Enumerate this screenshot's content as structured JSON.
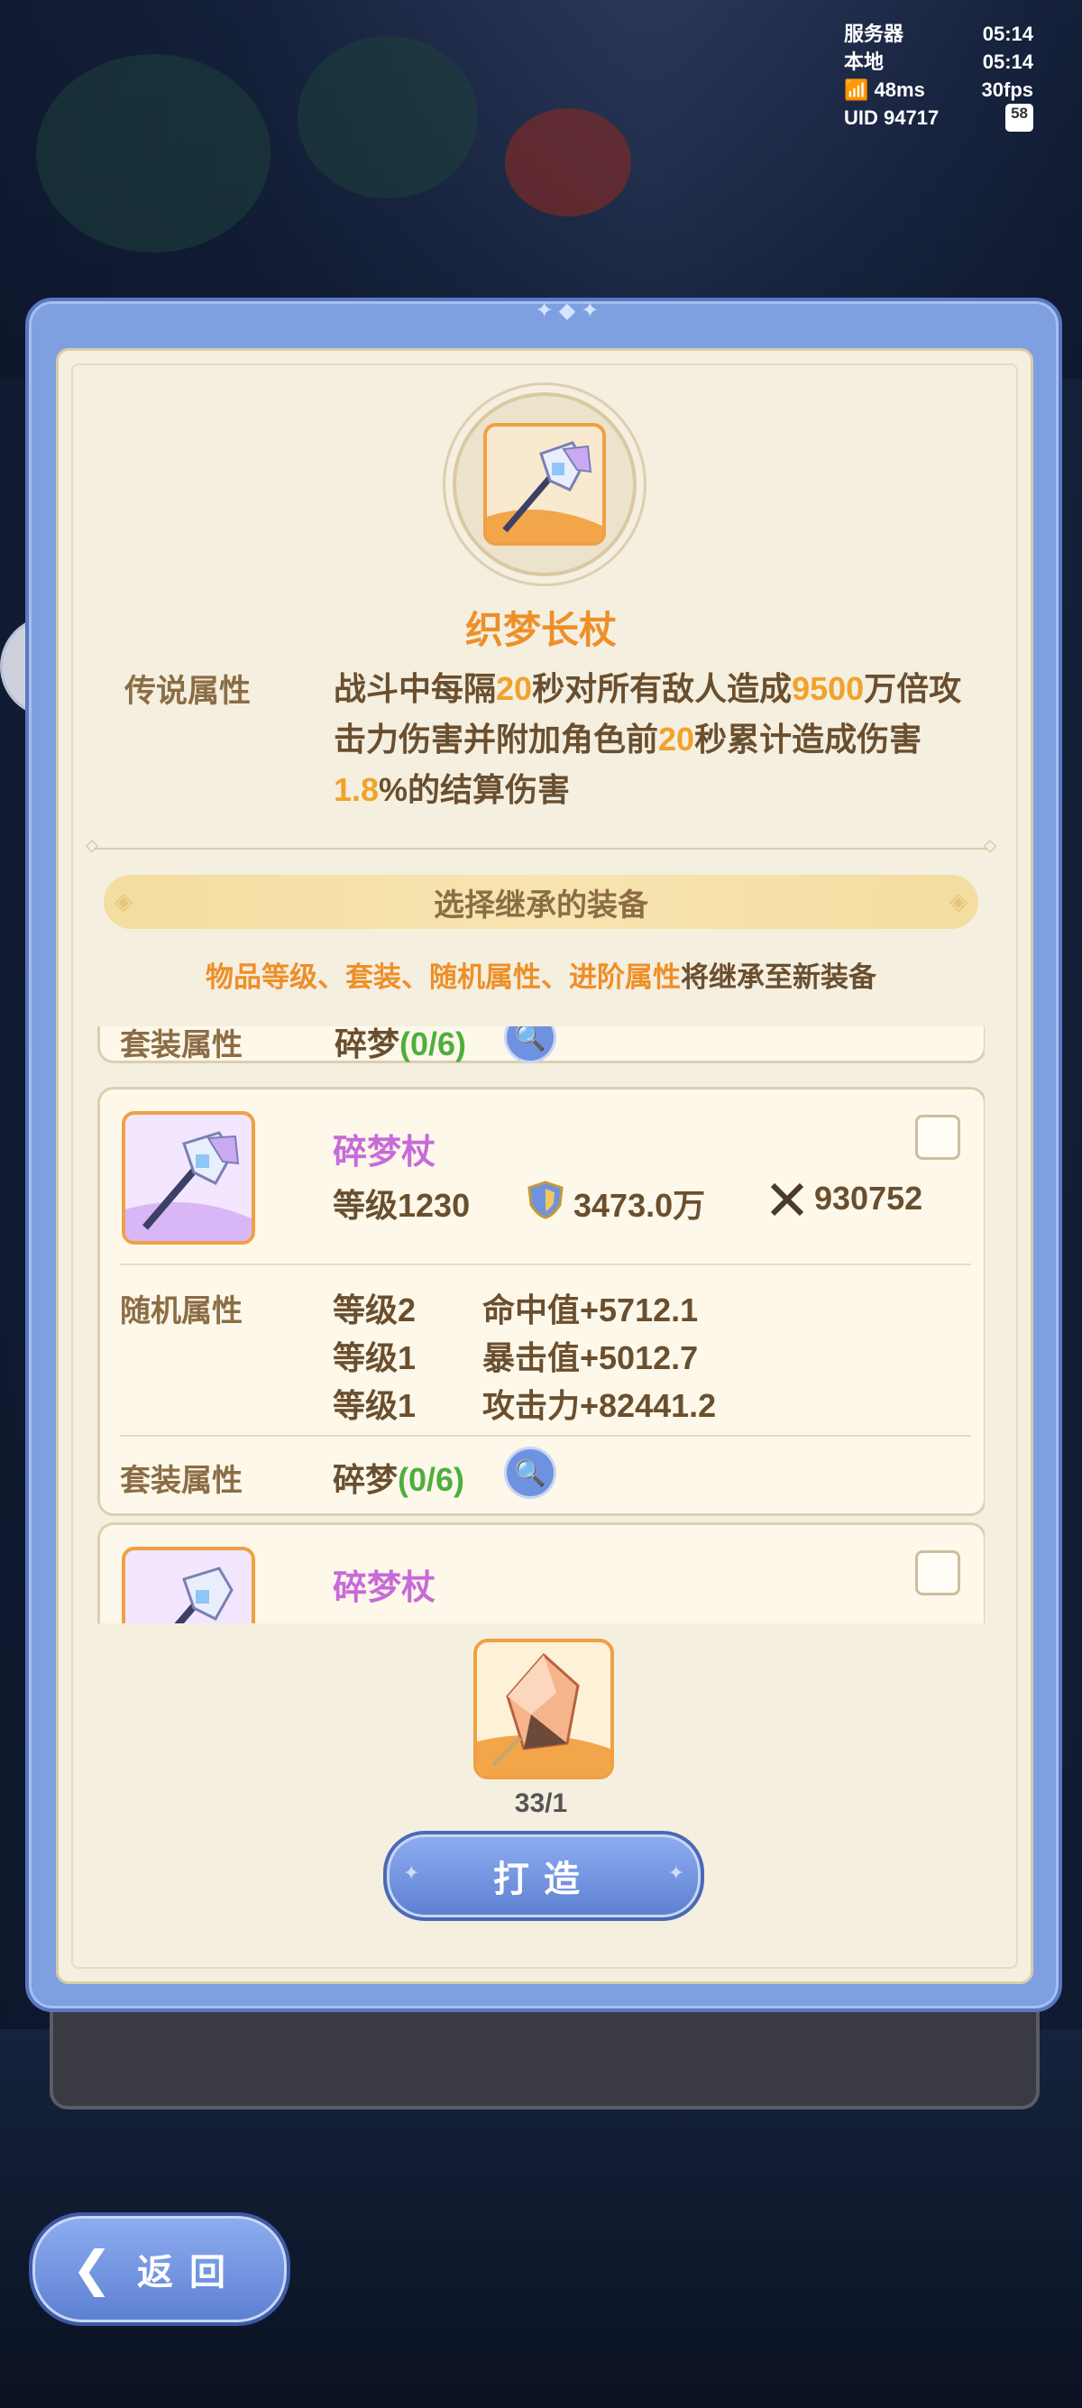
{
  "status": {
    "server_label": "服务器",
    "server_time": "05:14",
    "local_label": "本地",
    "local_time": "05:14",
    "ping": "48ms",
    "fps": "30fps",
    "uid": "UID 94717",
    "battery": "58"
  },
  "item": {
    "name": "织梦长杖",
    "legend_label": "传说属性",
    "legend_parts": [
      "战斗中每隔",
      "20",
      "秒对所有敌人造成",
      "9500",
      "万倍攻击力伤害并附加角色前",
      "20",
      "秒累计造成伤害",
      "1.8",
      "%的结算伤害"
    ]
  },
  "section": {
    "title": "选择继承的装备",
    "note_highlight": "物品等级、套装、随机属性、进阶属性",
    "note_rest": "将继承至新装备"
  },
  "list": {
    "partial_top": {
      "set_label": "套装属性",
      "set_name": "碎梦",
      "set_progress": "(0/6)"
    },
    "cards": [
      {
        "name": "碎梦杖",
        "level": "等级1230",
        "defense": "3473.0万",
        "attack": "930752",
        "random_label": "随机属性",
        "random_stats": [
          {
            "level": "等级2",
            "stat": "命中值+5712.1"
          },
          {
            "level": "等级1",
            "stat": "暴击值+5012.7"
          },
          {
            "level": "等级1",
            "stat": "攻击力+82441.2"
          }
        ],
        "set_label": "套装属性",
        "set_name": "碎梦",
        "set_progress": "(0/6)"
      },
      {
        "name": "碎梦杖"
      }
    ]
  },
  "material": {
    "count": "33/1"
  },
  "buttons": {
    "forge": "打造",
    "back": "返回"
  },
  "colors": {
    "accent_orange": "#ee8f28",
    "set_green": "#4fae3d",
    "item_purple": "#c86ad8",
    "frame_blue": "#7e9fe0"
  }
}
